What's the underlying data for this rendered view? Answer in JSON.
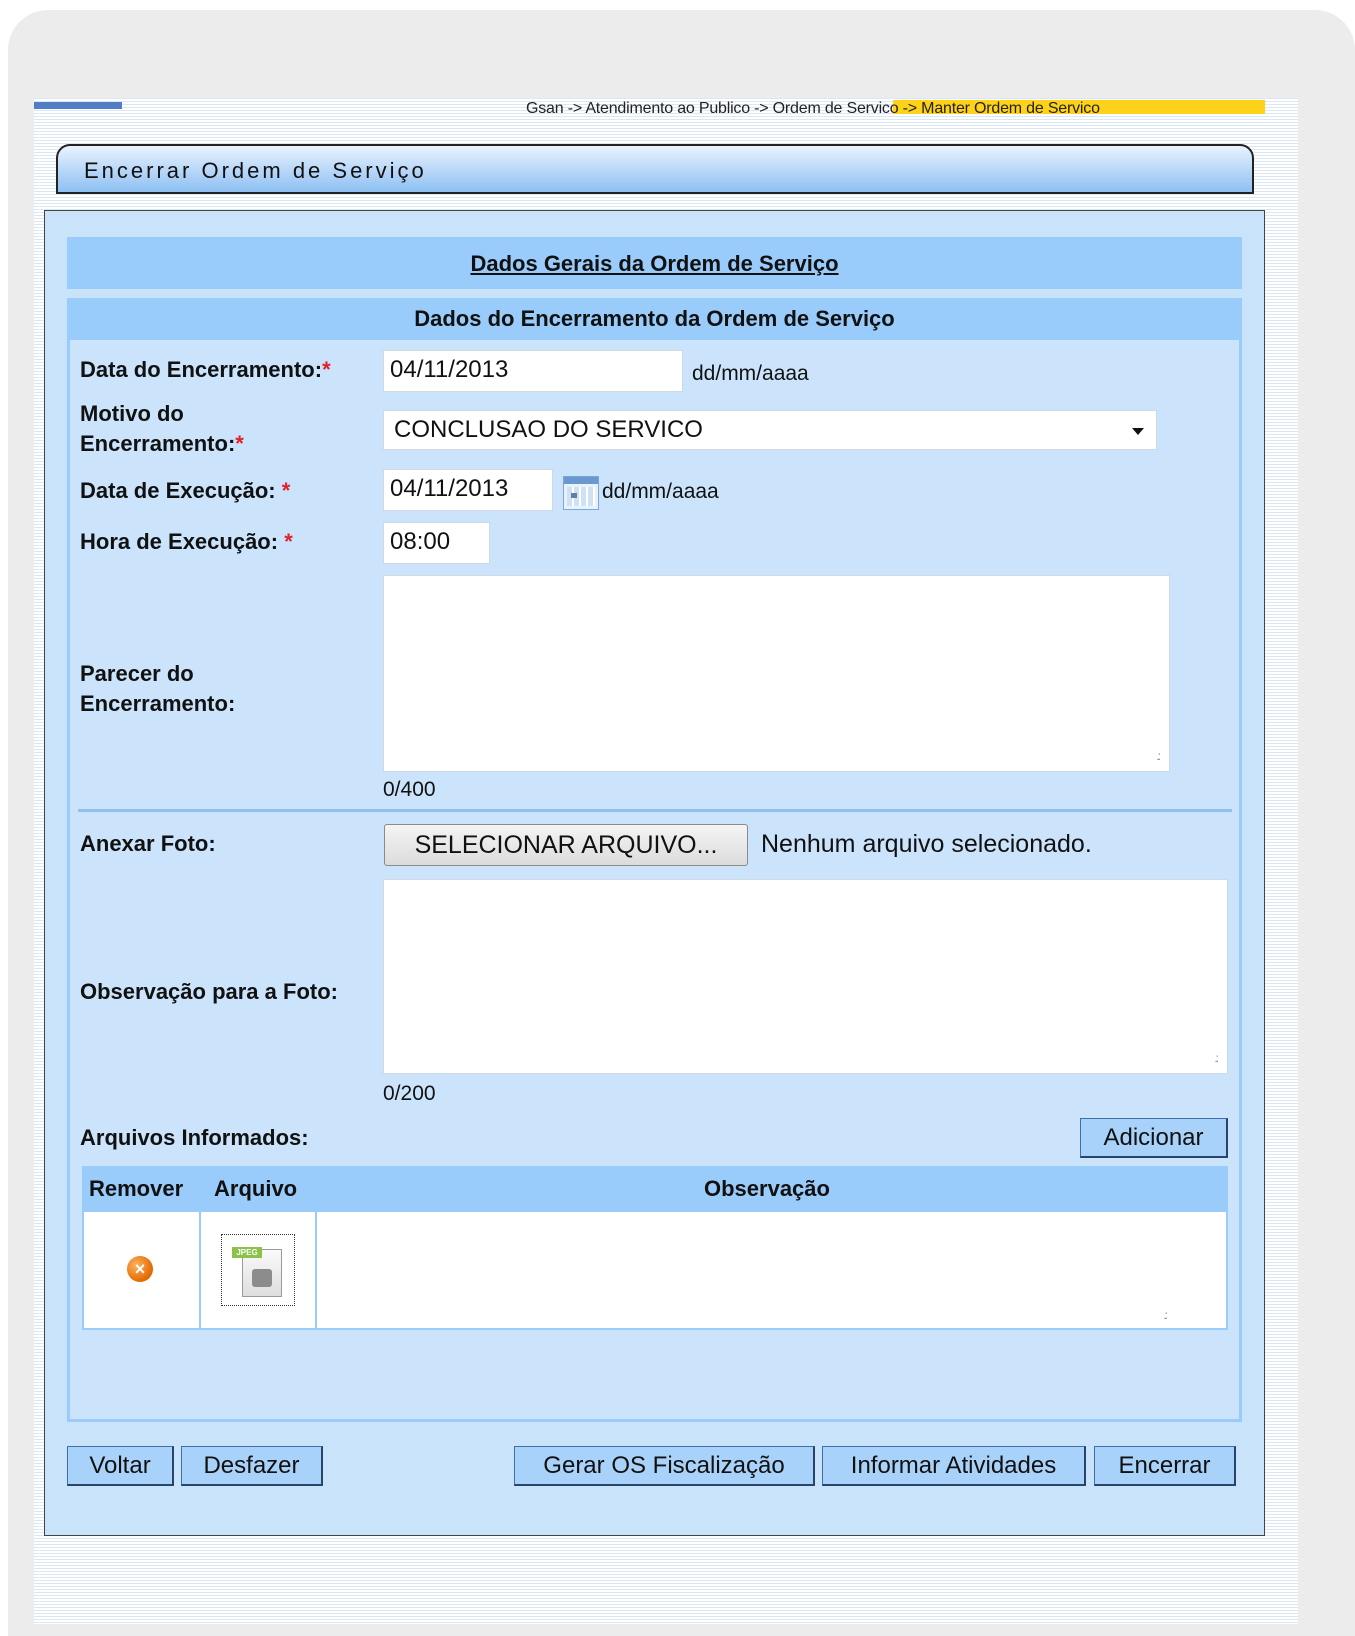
{
  "breadcrumb": "Gsan -> Atendimento ao Publico -> Ordem de Servico -> Manter Ordem de Servico",
  "window_title": "Encerrar Ordem de Serviço",
  "sections": {
    "general": "Dados Gerais da Ordem de Serviço",
    "closing": "Dados do Encerramento da Ordem de Serviço"
  },
  "form": {
    "data_encerramento_label": "Data do Encerramento:",
    "data_encerramento_value": "04/11/2013",
    "date_hint": "dd/mm/aaaa",
    "motivo_label_1": "Motivo do",
    "motivo_label_2": "Encerramento:",
    "motivo_value": "CONCLUSAO DO SERVICO",
    "data_execucao_label": "Data de Execução:",
    "data_execucao_value": "04/11/2013",
    "hora_execucao_label": "Hora de Execução:",
    "hora_execucao_value": "08:00",
    "parecer_label_1": "Parecer do",
    "parecer_label_2": "Encerramento:",
    "parecer_counter": "0/400",
    "anexar_foto_label": "Anexar Foto:",
    "file_button_label": "SELECIONAR ARQUIVO...",
    "file_status": "Nenhum arquivo selecionado.",
    "observacao_label": "Observação para a Foto:",
    "observacao_counter": "0/200",
    "arquivos_label": "Arquivos Informados:",
    "required_mark": "*"
  },
  "files_table": {
    "headers": [
      "Remover",
      "Arquivo",
      "Observação"
    ],
    "file_type_tag": "JPEG"
  },
  "buttons": {
    "adicionar": "Adicionar",
    "voltar": "Voltar",
    "desfazer": "Desfazer",
    "gerar_os": "Gerar OS Fiscalização",
    "informar_atividades": "Informar Atividades",
    "encerrar": "Encerrar"
  },
  "colors": {
    "header_blue": "#99cbfb",
    "panel_blue": "#c9e3fb",
    "required_red": "#e0202a",
    "breadcrumb_highlight": "#ffd21a"
  },
  "icons": [
    "calendar-icon",
    "remove-icon",
    "jpeg-file-icon",
    "chevron-down-icon"
  ]
}
